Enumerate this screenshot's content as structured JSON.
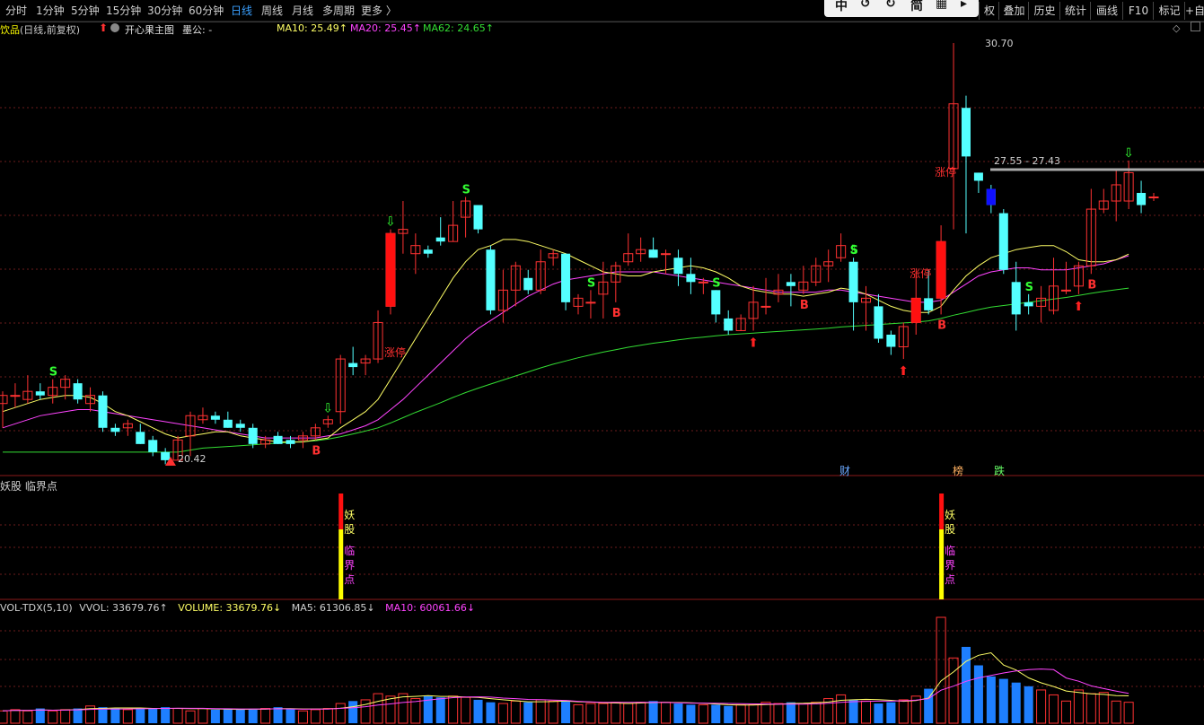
{
  "toolbar": {
    "periods": [
      {
        "label": "分时",
        "active": false
      },
      {
        "label": "1分钟",
        "active": false
      },
      {
        "label": "5分钟",
        "active": false
      },
      {
        "label": "15分钟",
        "active": false
      },
      {
        "label": "30分钟",
        "active": false
      },
      {
        "label": "60分钟",
        "active": false
      },
      {
        "label": "日线",
        "active": true
      },
      {
        "label": "周线",
        "active": false
      },
      {
        "label": "月线",
        "active": false
      },
      {
        "label": "多周期",
        "active": false
      },
      {
        "label": "更多 〉",
        "active": false
      }
    ],
    "float_buttons": [
      "中",
      "↺",
      "↻",
      "简",
      "▦",
      "▸"
    ],
    "right_buttons": [
      "权",
      "叠加",
      "历史",
      "统计",
      "画线",
      "F10",
      "标记",
      "+自"
    ]
  },
  "main_header": {
    "stock_name": "饮品",
    "mode": "(日线,前复权)",
    "indicator_name": "开心果主图",
    "extra": "墨公: -",
    "ma10": "MA10: 25.49↑",
    "ma20": "MA20: 25.45↑",
    "ma62": "MA62: 24.65↑"
  },
  "price_labels": {
    "high": "30.70",
    "low": "20.42",
    "range": "27.55 - 27.43"
  },
  "annotations": {
    "limit_up": "涨停",
    "sell": "S",
    "buy": "B",
    "news_cai": "财",
    "news_bang": "榜",
    "news_die": "跌"
  },
  "sub1": {
    "title": "妖股 临界点",
    "tag_chars": [
      "妖",
      "股",
      "临",
      "界",
      "点"
    ]
  },
  "sub2": {
    "title": "VOL-TDX(5,10)",
    "vvol": "VVOL: 33679.76↑",
    "volume": "VOLUME: 33679.76↓",
    "ma5": "MA5: 61306.85↓",
    "ma10": "MA10: 60061.66↓"
  },
  "colors": {
    "up": "#ff3232",
    "down": "#54ffff",
    "ma10": "#ffff66",
    "ma20": "#ff44ff",
    "ma62": "#33dd33",
    "vol_down": "#1e7fff"
  },
  "chart_data": {
    "type": "candlestick",
    "price_ticks": [
      30.7,
      20.42
    ],
    "candles": [
      [
        21.8,
        22.0,
        21.2,
        22.1
      ],
      [
        22.0,
        22.0,
        21.7,
        22.3
      ],
      [
        21.9,
        22.1,
        21.8,
        22.5
      ],
      [
        22.1,
        22.0,
        21.9,
        22.3
      ],
      [
        22.0,
        22.2,
        21.8,
        22.4
      ],
      [
        22.2,
        22.4,
        21.9,
        22.5
      ],
      [
        22.3,
        21.9,
        21.8,
        22.4
      ],
      [
        21.8,
        22.0,
        21.6,
        22.2
      ],
      [
        22.0,
        21.2,
        21.1,
        22.1
      ],
      [
        21.2,
        21.1,
        21.0,
        21.3
      ],
      [
        21.2,
        21.3,
        21.0,
        21.4
      ],
      [
        21.1,
        20.8,
        20.8,
        21.3
      ],
      [
        20.9,
        20.6,
        20.5,
        21.0
      ],
      [
        20.6,
        20.4,
        20.3,
        20.7
      ],
      [
        20.4,
        20.9,
        20.4,
        21.0
      ],
      [
        21.0,
        21.5,
        20.5,
        21.6
      ],
      [
        21.4,
        21.5,
        21.3,
        21.7
      ],
      [
        21.5,
        21.4,
        21.3,
        21.6
      ],
      [
        21.4,
        21.2,
        21.2,
        21.6
      ],
      [
        21.3,
        21.2,
        21.1,
        21.4
      ],
      [
        21.2,
        20.8,
        20.7,
        21.3
      ],
      [
        20.8,
        20.9,
        20.7,
        21.0
      ],
      [
        21.0,
        20.8,
        20.8,
        21.1
      ],
      [
        20.9,
        20.8,
        20.7,
        21.0
      ],
      [
        20.9,
        21.0,
        20.7,
        21.1
      ],
      [
        21.0,
        21.2,
        20.9,
        21.3
      ],
      [
        21.3,
        21.4,
        21.2,
        21.5
      ],
      [
        21.6,
        22.9,
        21.3,
        23.0
      ],
      [
        22.8,
        22.7,
        22.5,
        23.2
      ],
      [
        22.8,
        22.9,
        22.5,
        23.0
      ],
      [
        22.9,
        23.8,
        22.8,
        24.1
      ],
      [
        24.2,
        26.0,
        24.0,
        26.1
      ],
      [
        26.0,
        26.1,
        25.5,
        26.8
      ],
      [
        25.5,
        25.7,
        25.0,
        26.0
      ],
      [
        25.6,
        25.5,
        25.4,
        25.7
      ],
      [
        25.9,
        25.8,
        25.7,
        26.4
      ],
      [
        25.8,
        26.2,
        25.8,
        26.8
      ],
      [
        26.4,
        26.8,
        25.9,
        26.9
      ],
      [
        26.7,
        26.1,
        26.0,
        26.6
      ],
      [
        25.6,
        24.1,
        24.0,
        25.7
      ],
      [
        24.1,
        24.6,
        23.8,
        25.1
      ],
      [
        24.6,
        25.2,
        24.2,
        25.3
      ],
      [
        24.9,
        24.6,
        24.5,
        25.1
      ],
      [
        24.6,
        25.3,
        24.5,
        25.6
      ],
      [
        25.4,
        25.5,
        25.2,
        25.6
      ],
      [
        25.5,
        24.3,
        24.1,
        25.5
      ],
      [
        24.2,
        24.4,
        24.0,
        24.5
      ],
      [
        24.3,
        24.3,
        23.9,
        24.6
      ],
      [
        24.5,
        24.8,
        23.9,
        25.3
      ],
      [
        24.8,
        25.2,
        24.3,
        25.3
      ],
      [
        25.3,
        25.5,
        25.2,
        26.0
      ],
      [
        25.5,
        25.6,
        25.3,
        25.9
      ],
      [
        25.6,
        25.4,
        25.4,
        25.9
      ],
      [
        25.5,
        25.5,
        25.0,
        25.6
      ],
      [
        25.4,
        25.0,
        24.7,
        25.6
      ],
      [
        25.0,
        24.8,
        24.5,
        25.4
      ],
      [
        24.8,
        24.8,
        24.5,
        24.9
      ],
      [
        24.6,
        24.0,
        23.8,
        24.6
      ],
      [
        23.9,
        23.6,
        23.5,
        24.1
      ],
      [
        23.6,
        23.9,
        23.6,
        24.0
      ],
      [
        23.9,
        24.3,
        23.6,
        24.7
      ],
      [
        24.2,
        24.2,
        24.0,
        24.9
      ],
      [
        24.5,
        24.6,
        24.3,
        25.0
      ],
      [
        24.8,
        24.7,
        24.2,
        25.0
      ],
      [
        24.6,
        24.8,
        24.5,
        25.2
      ],
      [
        24.8,
        25.2,
        24.7,
        25.4
      ],
      [
        25.2,
        25.3,
        24.8,
        25.6
      ],
      [
        25.4,
        25.7,
        25.3,
        26.0
      ],
      [
        25.3,
        24.3,
        23.6,
        25.4
      ],
      [
        24.3,
        24.4,
        23.6,
        24.7
      ],
      [
        24.2,
        23.4,
        23.3,
        24.5
      ],
      [
        23.5,
        23.2,
        23.0,
        23.6
      ],
      [
        23.2,
        23.7,
        22.9,
        23.8
      ],
      [
        23.8,
        24.4,
        23.5,
        25.0
      ],
      [
        24.4,
        24.1,
        24.0,
        25.1
      ],
      [
        24.4,
        25.8,
        24.0,
        26.2
      ],
      [
        27.6,
        29.2,
        26.1,
        30.7
      ],
      [
        29.1,
        27.9,
        26.0,
        29.4
      ],
      [
        27.5,
        27.3,
        27.0,
        27.5
      ],
      [
        27.1,
        26.7,
        26.5,
        27.2
      ],
      [
        26.5,
        25.1,
        25.0,
        26.6
      ],
      [
        24.8,
        24.0,
        23.6,
        25.3
      ],
      [
        24.3,
        24.2,
        24.0,
        24.5
      ],
      [
        24.2,
        24.4,
        23.8,
        24.7
      ],
      [
        24.1,
        24.7,
        24.0,
        25.4
      ],
      [
        24.6,
        24.6,
        24.5,
        25.3
      ],
      [
        24.7,
        25.2,
        24.5,
        25.3
      ],
      [
        25.2,
        26.6,
        25.0,
        27.1
      ],
      [
        26.6,
        26.8,
        26.5,
        27.1
      ],
      [
        26.8,
        27.2,
        26.3,
        27.6
      ],
      [
        26.8,
        27.5,
        26.6,
        27.8
      ],
      [
        27.0,
        26.7,
        26.5,
        27.3
      ],
      [
        26.9,
        26.9,
        26.8,
        27.0
      ]
    ],
    "ma10": [
      21.6,
      21.7,
      21.8,
      21.9,
      21.95,
      22.0,
      22.0,
      21.95,
      21.8,
      21.6,
      21.5,
      21.35,
      21.2,
      21.05,
      20.95,
      21.0,
      21.05,
      21.1,
      21.1,
      21.0,
      20.95,
      20.9,
      20.85,
      20.85,
      20.85,
      20.9,
      20.95,
      21.2,
      21.4,
      21.6,
      21.9,
      22.4,
      22.9,
      23.4,
      23.9,
      24.4,
      24.9,
      25.3,
      25.6,
      25.7,
      25.85,
      25.85,
      25.8,
      25.7,
      25.6,
      25.5,
      25.35,
      25.2,
      25.05,
      25.0,
      24.95,
      24.95,
      25.05,
      25.1,
      25.15,
      25.2,
      25.15,
      25.05,
      24.9,
      24.7,
      24.6,
      24.55,
      24.5,
      24.5,
      24.45,
      24.5,
      24.55,
      24.65,
      24.6,
      24.5,
      24.35,
      24.2,
      24.1,
      24.05,
      24.05,
      24.2,
      24.6,
      24.95,
      25.2,
      25.4,
      25.5,
      25.6,
      25.65,
      25.7,
      25.7,
      25.55,
      25.35,
      25.3,
      25.3,
      25.35,
      25.49
    ],
    "ma20": [
      21.2,
      21.3,
      21.4,
      21.5,
      21.55,
      21.6,
      21.65,
      21.65,
      21.6,
      21.55,
      21.5,
      21.45,
      21.4,
      21.35,
      21.3,
      21.25,
      21.2,
      21.15,
      21.1,
      21.05,
      21.0,
      20.95,
      20.95,
      20.95,
      20.95,
      20.95,
      21.0,
      21.05,
      21.15,
      21.25,
      21.4,
      21.65,
      21.9,
      22.2,
      22.5,
      22.8,
      23.1,
      23.4,
      23.65,
      23.85,
      24.05,
      24.25,
      24.45,
      24.6,
      24.75,
      24.85,
      24.9,
      24.95,
      25.0,
      25.05,
      25.05,
      25.05,
      25.05,
      25.0,
      24.95,
      24.9,
      24.85,
      24.8,
      24.75,
      24.7,
      24.65,
      24.6,
      24.55,
      24.55,
      24.55,
      24.55,
      24.6,
      24.6,
      24.55,
      24.5,
      24.45,
      24.4,
      24.35,
      24.3,
      24.3,
      24.35,
      24.55,
      24.75,
      24.95,
      25.05,
      25.1,
      25.15,
      25.15,
      25.1,
      25.1,
      25.1,
      25.15,
      25.2,
      25.25,
      25.35,
      25.45
    ],
    "ma62": [
      20.6,
      20.6,
      20.6,
      20.6,
      20.6,
      20.6,
      20.6,
      20.6,
      20.6,
      20.6,
      20.6,
      20.6,
      20.6,
      20.6,
      20.6,
      20.65,
      20.7,
      20.72,
      20.74,
      20.76,
      20.78,
      20.8,
      20.82,
      20.84,
      20.86,
      20.88,
      20.92,
      20.98,
      21.05,
      21.12,
      21.2,
      21.32,
      21.45,
      21.58,
      21.7,
      21.82,
      21.95,
      22.07,
      22.18,
      22.28,
      22.38,
      22.48,
      22.58,
      22.68,
      22.77,
      22.85,
      22.93,
      23.0,
      23.07,
      23.13,
      23.19,
      23.24,
      23.29,
      23.33,
      23.37,
      23.41,
      23.44,
      23.47,
      23.5,
      23.52,
      23.54,
      23.56,
      23.58,
      23.6,
      23.62,
      23.64,
      23.66,
      23.69,
      23.71,
      23.73,
      23.75,
      23.77,
      23.79,
      23.81,
      23.84,
      23.9,
      23.98,
      24.05,
      24.12,
      24.18,
      24.22,
      24.26,
      24.3,
      24.34,
      24.38,
      24.42,
      24.47,
      24.52,
      24.57,
      24.61,
      24.65
    ],
    "volume": [
      10,
      11,
      10,
      12,
      10,
      11,
      12,
      14,
      13,
      12,
      11,
      12,
      12,
      13,
      12,
      10,
      12,
      11,
      12,
      11,
      11,
      12,
      13,
      12,
      10,
      11,
      12,
      16,
      18,
      19,
      24,
      22,
      24,
      20,
      22,
      21,
      22,
      21,
      19,
      17,
      16,
      18,
      17,
      19,
      18,
      18,
      15,
      16,
      16,
      17,
      16,
      17,
      18,
      17,
      16,
      15,
      15,
      15,
      14,
      15,
      15,
      17,
      16,
      17,
      16,
      17,
      20,
      23,
      19,
      18,
      16,
      17,
      19,
      22,
      28,
      86,
      53,
      62,
      47,
      38,
      36,
      33,
      30,
      27,
      23,
      18,
      27,
      24,
      25,
      18,
      17
    ],
    "sell_markers": [
      4,
      37,
      47,
      57,
      68,
      82
    ],
    "buy_markers": [
      25,
      49,
      64,
      75,
      87
    ],
    "up_arrows": [
      60,
      72,
      86
    ],
    "down_arrows": [
      26,
      31,
      68,
      90
    ]
  }
}
